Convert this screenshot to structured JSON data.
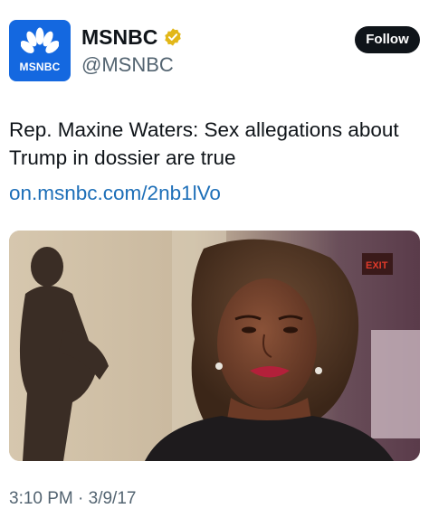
{
  "account": {
    "display_name": "MSNBC",
    "handle": "@MSNBC",
    "avatar_label": "MSNBC",
    "avatar_icon": "peacock-logo-icon",
    "verified_icon": "verified-badge-icon",
    "brand_color": "#1468e0",
    "verified_color": "#e2b719"
  },
  "follow_button": {
    "label": "Follow"
  },
  "tweet": {
    "text": "Rep. Maxine Waters: Sex allegations about Trump in dossier are true",
    "link": "on.msnbc.com/2nb1lVo",
    "timestamp": "3:10 PM · 3/9/17"
  },
  "media": {
    "sign_text": "EXIT"
  }
}
